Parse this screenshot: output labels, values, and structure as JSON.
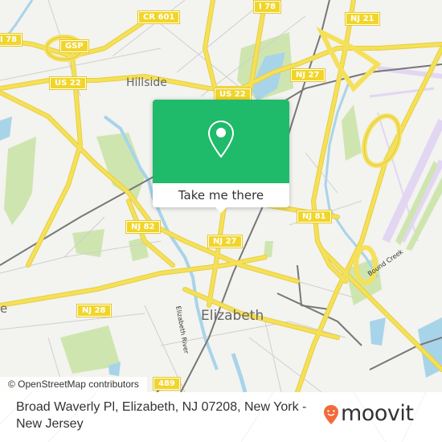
{
  "map": {
    "attribution": "© OpenStreetMap contributors",
    "colors": {
      "background": "#f3f3ef",
      "road": "#f5e05a",
      "road_casing": "#e7cf3a",
      "water": "#a8d4ea",
      "park": "#cfe5b0",
      "rail": "#777777",
      "airport": "#e6ddf3",
      "minor_road": "#c8c8c8"
    },
    "road_shields": [
      {
        "label": "I 78",
        "id": "i78-left"
      },
      {
        "label": "GSP",
        "id": "gsp"
      },
      {
        "label": "CR 601",
        "id": "cr601"
      },
      {
        "label": "I 78",
        "id": "i78"
      },
      {
        "label": "NJ 21",
        "id": "nj21"
      },
      {
        "label": "US 22",
        "id": "us22-left"
      },
      {
        "label": "US 22",
        "id": "us22"
      },
      {
        "label": "NJ 27",
        "id": "nj27-top"
      },
      {
        "label": "NJ 82",
        "id": "nj82"
      },
      {
        "label": "NJ 27",
        "id": "nj27"
      },
      {
        "label": "NJ 81",
        "id": "nj81"
      },
      {
        "label": "NJ 28",
        "id": "nj28"
      },
      {
        "label": "489",
        "id": "cr489"
      }
    ],
    "places": [
      {
        "label": "Hillside",
        "id": "hillside"
      },
      {
        "label": "Elizabeth",
        "id": "elizabeth"
      },
      {
        "label": "e",
        "id": "partial-place"
      }
    ],
    "water_labels": [
      {
        "label": "Elizabeth River",
        "id": "elizabeth-river"
      },
      {
        "label": "Bound Creek",
        "id": "bound-creek"
      }
    ]
  },
  "popup": {
    "icon": "location-pin-icon",
    "button_label": "Take me there",
    "color": "#1fba6a"
  },
  "footer": {
    "address": "Broad Waverly Pl, Elizabeth, NJ 07208, New York - New Jersey",
    "brand": "moovit",
    "brand_color": "#f26b3a"
  }
}
